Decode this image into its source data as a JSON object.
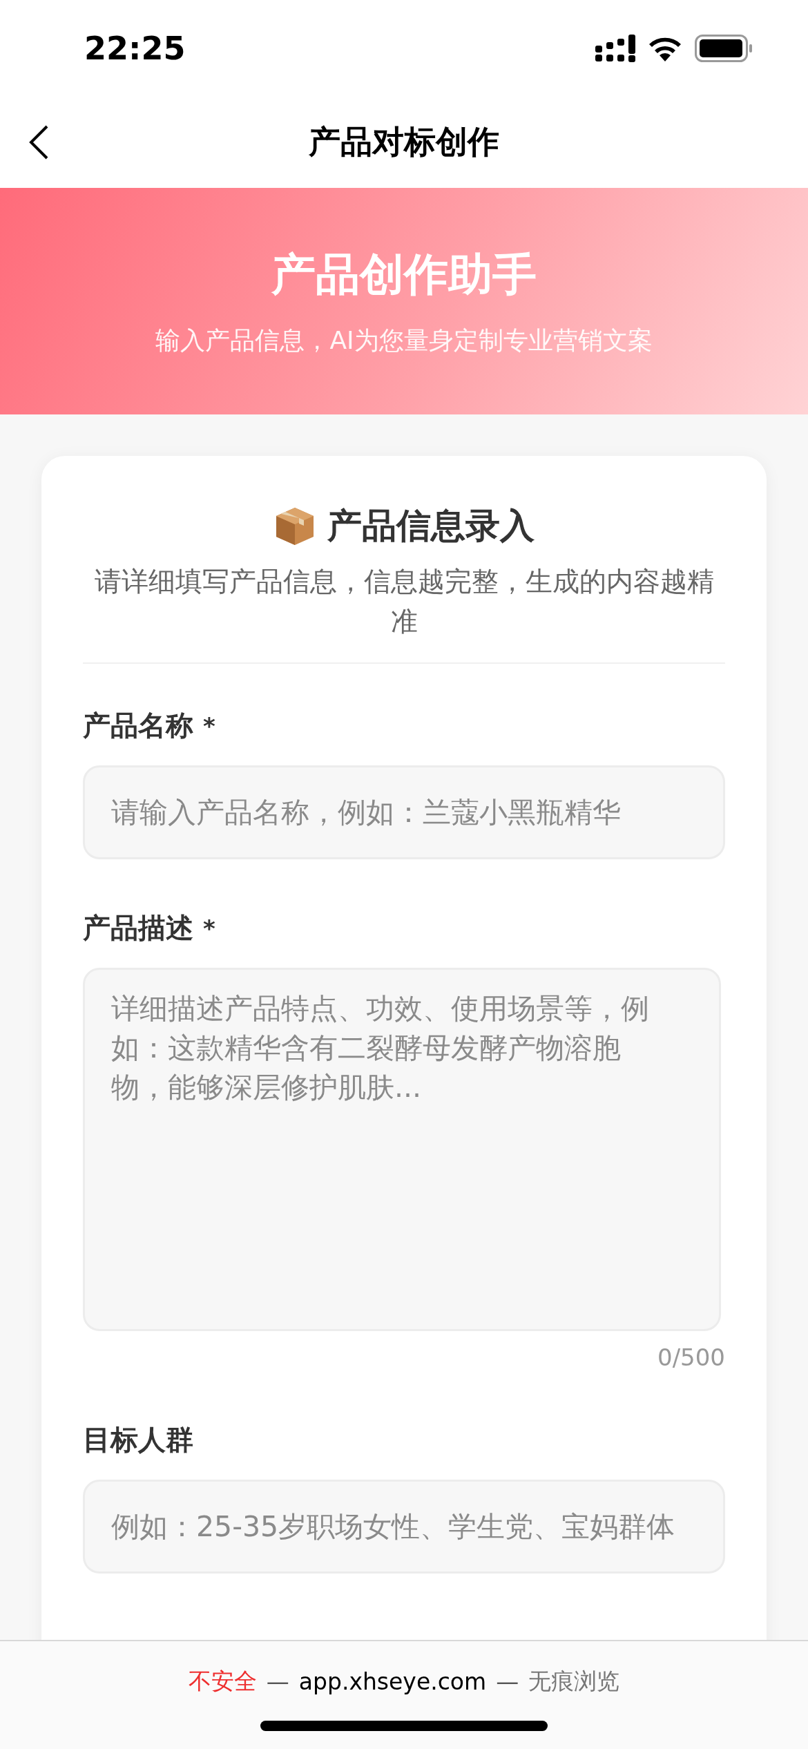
{
  "status_bar": {
    "time": "22:25"
  },
  "nav": {
    "title": "产品对标创作"
  },
  "banner": {
    "title": "产品创作助手",
    "subtitle": "输入产品信息，AI为您量身定制专业营销文案"
  },
  "card": {
    "title": "产品信息录入",
    "subtitle": "请详细填写产品信息，信息越完整，生成的内容越精准"
  },
  "fields": [
    {
      "label": "产品名称",
      "required_mark": "*",
      "kind": "input",
      "placeholder": "请输入产品名称，例如：兰蔻小黑瓶精华"
    },
    {
      "label": "产品描述",
      "required_mark": "*",
      "kind": "textarea",
      "placeholder": "详细描述产品特点、功效、使用场景等，例如：这款精华含有二裂酵母发酵产物溶胞物，能够深层修护肌肤...",
      "counter": "0/500"
    },
    {
      "label": "目标人群",
      "kind": "input",
      "placeholder": "例如：25-35岁职场女性、学生党、宝妈群体"
    }
  ],
  "browser_bar": {
    "security": "不安全",
    "separator_1": "—",
    "url": "app.xhseye.com",
    "separator_2": "—",
    "mode": "无痕浏览"
  }
}
